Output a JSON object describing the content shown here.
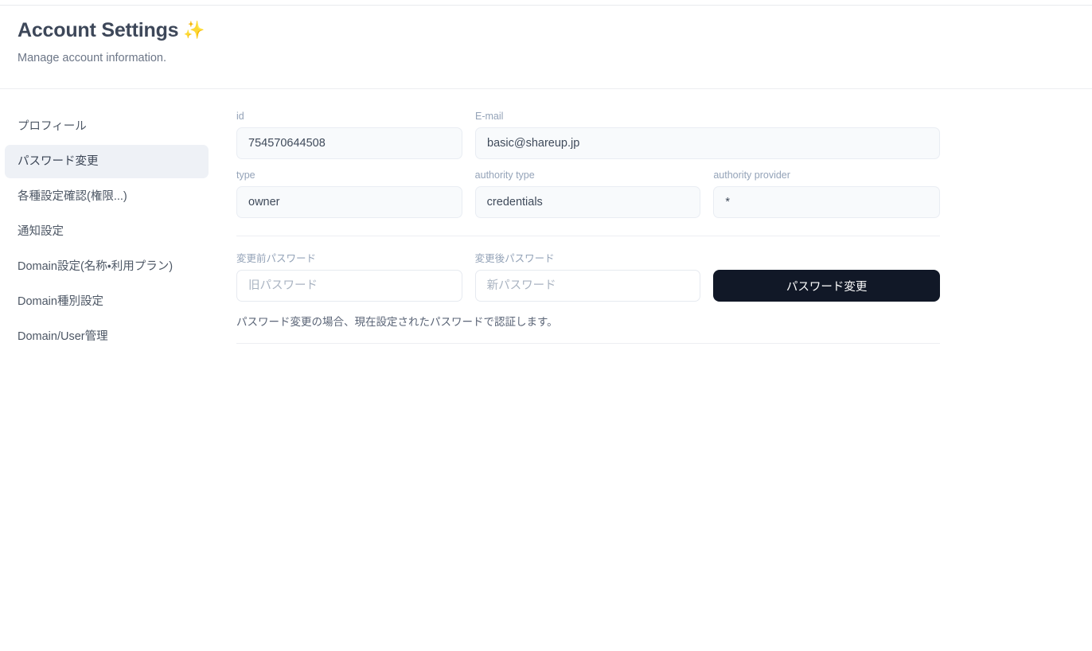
{
  "header": {
    "title": "Account Settings",
    "title_icon": "sparkles-icon",
    "sparkle_glyph": "✨",
    "subtitle": "Manage account information."
  },
  "sidebar": {
    "items": [
      {
        "label": "プロフィール",
        "active": false
      },
      {
        "label": "パスワード変更",
        "active": true
      },
      {
        "label": "各種設定確認(権限...)",
        "active": false
      },
      {
        "label": "通知設定",
        "active": false
      },
      {
        "label": "Domain設定(名称・利用プラン)",
        "active": false
      },
      {
        "label": "Domain種別設定",
        "active": false
      },
      {
        "label": "Domain/User管理",
        "active": false
      }
    ]
  },
  "form": {
    "id": {
      "label": "id",
      "value": "754570644508"
    },
    "email": {
      "label": "E-mail",
      "value": "basic@shareup.jp"
    },
    "type": {
      "label": "type",
      "value": "owner"
    },
    "authority_type": {
      "label": "authority type",
      "value": "credentials"
    },
    "authority_provider": {
      "label": "authority provider",
      "value": "*"
    }
  },
  "password": {
    "old": {
      "label": "変更前パスワード",
      "placeholder": "旧パスワード",
      "value": ""
    },
    "new": {
      "label": "変更後パスワード",
      "placeholder": "新パスワード",
      "value": ""
    },
    "submit_label": "パスワード変更",
    "helper": "パスワード変更の場合、現在設定されたパスワードで認証します。"
  },
  "colors": {
    "accent_button": "#111827",
    "active_nav_bg": "#eef1f6",
    "label": "#94a3b8",
    "sparkle": "#f5c542"
  }
}
